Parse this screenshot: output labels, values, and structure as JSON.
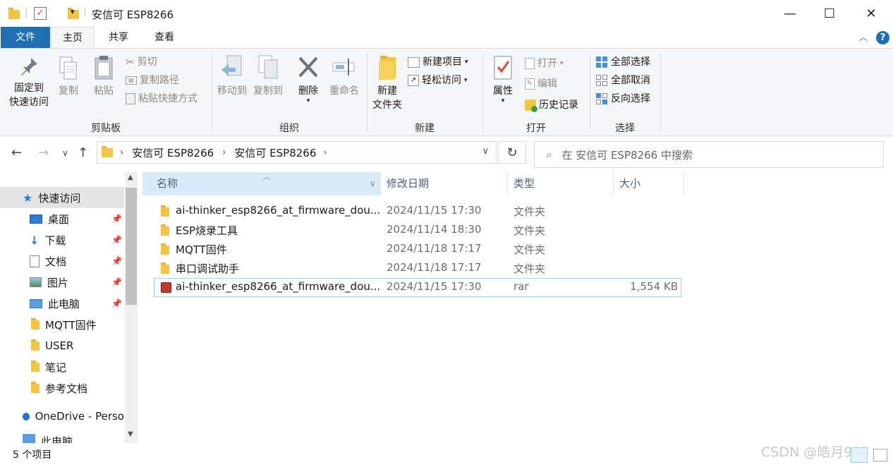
{
  "window": {
    "title": "安信可 ESP8266",
    "minimize": "—",
    "maximize": "☐",
    "close": "✕"
  },
  "ribbon_tabs": [
    "文件",
    "主页",
    "共享",
    "查看"
  ],
  "ribbon": {
    "clipboard": {
      "label": "剪贴板",
      "pin_quick_access": "固定到\n快速访问",
      "pin_line1": "固定到",
      "pin_line2": "快速访问",
      "copy": "复制",
      "paste": "粘贴",
      "cut": "剪切",
      "copy_path": "复制路径",
      "paste_shortcut": "粘贴快捷方式"
    },
    "organize": {
      "label": "组织",
      "move_to": "移动到",
      "copy_to": "复制到",
      "delete": "删除",
      "rename": "重命名"
    },
    "new": {
      "label": "新建",
      "new_folder_line1": "新建",
      "new_folder_line2": "文件夹",
      "new_item": "新建项目",
      "easy_access": "轻松访问"
    },
    "open": {
      "label": "打开",
      "properties": "属性",
      "open": "打开",
      "edit": "编辑",
      "history": "历史记录"
    },
    "select": {
      "label": "选择",
      "select_all": "全部选择",
      "select_none": "全部取消",
      "invert": "反向选择"
    }
  },
  "address": {
    "crumbs": [
      "安信可 ESP8266",
      "安信可 ESP8266"
    ],
    "search_placeholder": "在 安信可 ESP8266 中搜索"
  },
  "nav": {
    "quick_access": "快速访问",
    "items": [
      {
        "label": "桌面",
        "pinned": true
      },
      {
        "label": "下载",
        "pinned": true
      },
      {
        "label": "文档",
        "pinned": true
      },
      {
        "label": "图片",
        "pinned": true
      },
      {
        "label": "此电脑",
        "pinned": true
      },
      {
        "label": "MQTT固件",
        "pinned": false
      },
      {
        "label": "USER",
        "pinned": false
      },
      {
        "label": "笔记",
        "pinned": false
      },
      {
        "label": "参考文档",
        "pinned": false
      }
    ],
    "onedrive": "OneDrive - Perso",
    "this_pc": "此电脑"
  },
  "columns": [
    "名称",
    "修改日期",
    "类型",
    "大小"
  ],
  "files": [
    {
      "name": "ai-thinker_esp8266_at_firmware_dou...",
      "date": "2024/11/15 17:30",
      "type": "文件夹",
      "size": "",
      "kind": "folder"
    },
    {
      "name": "ESP烧录工具",
      "date": "2024/11/14 18:30",
      "type": "文件夹",
      "size": "",
      "kind": "folder"
    },
    {
      "name": "MQTT固件",
      "date": "2024/11/18 17:17",
      "type": "文件夹",
      "size": "",
      "kind": "folder"
    },
    {
      "name": "串口调试助手",
      "date": "2024/11/18 17:17",
      "type": "文件夹",
      "size": "",
      "kind": "folder"
    },
    {
      "name": "ai-thinker_esp8266_at_firmware_dou...",
      "date": "2024/11/15 17:30",
      "type": "rar",
      "size": "1,554 KB",
      "kind": "rar"
    }
  ],
  "status": {
    "count": "5 个项目"
  },
  "watermark": "CSDN @皓月905",
  "colors": {
    "accent": "#1f6fb4",
    "ribbon_bg": "#f5f6f7",
    "selection_border": "#99d1ff",
    "header_hover": "#d9ebf9"
  }
}
